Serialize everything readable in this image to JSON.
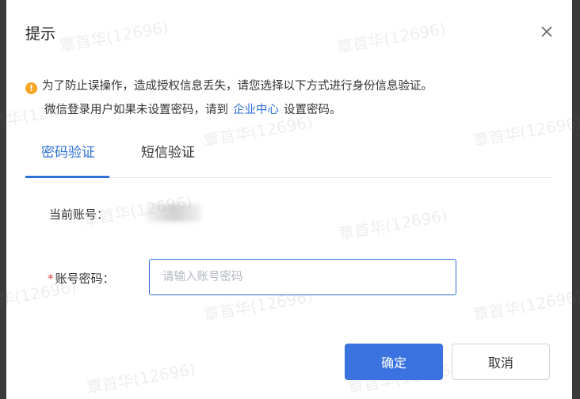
{
  "dialog": {
    "title": "提示",
    "watermark": "覃首华(12696)",
    "notice": {
      "line1": "为了防止误操作，造成授权信息丢失，请您选择以下方式进行身份信息验证。",
      "line2_prefix": "微信登录用户如果未设置密码，请到",
      "link": "企业中心",
      "line2_suffix": "设置密码。"
    },
    "tabs": [
      {
        "label": "密码验证",
        "active": true
      },
      {
        "label": "短信验证",
        "active": false
      }
    ],
    "account": {
      "label": "当前账号："
    },
    "password": {
      "required_mark": "*",
      "label": "账号密码：",
      "placeholder": "请输入账号密码",
      "value": ""
    },
    "buttons": {
      "confirm": "确定",
      "cancel": "取消"
    }
  },
  "colors": {
    "accent": "#2f6fd8",
    "warning": "#f5a623",
    "required": "#e54545"
  },
  "icons": {
    "close": "close-icon",
    "warning": "warning-icon"
  }
}
